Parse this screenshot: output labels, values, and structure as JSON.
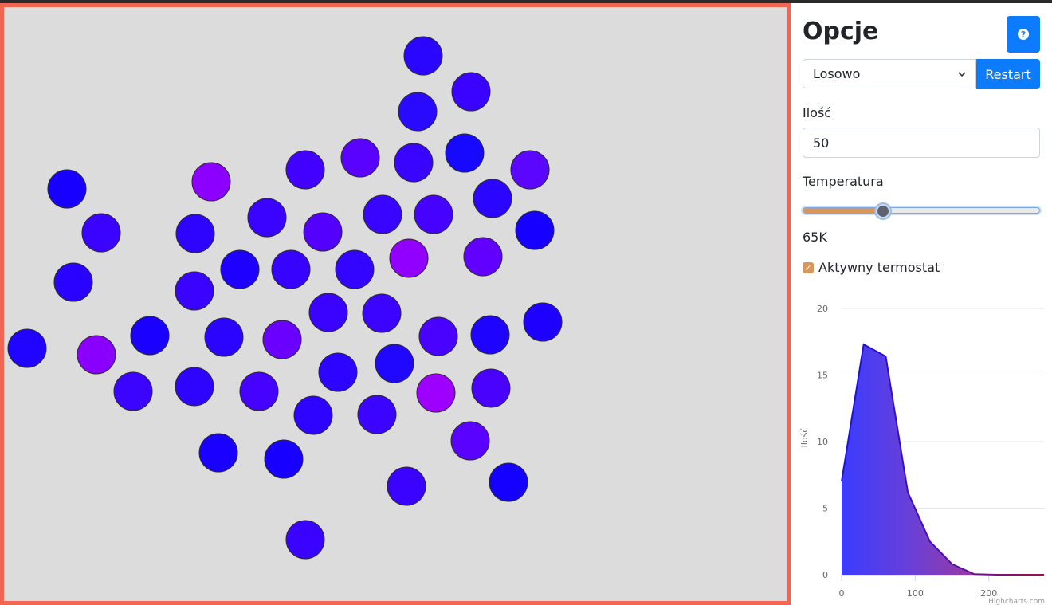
{
  "panel": {
    "title": "Opcje",
    "help_icon": "question-circle-icon",
    "mode_select": {
      "value": "Losowo"
    },
    "restart_label": "Restart",
    "count_label": "Ilość",
    "count_value": "50",
    "temperature_label": "Temperatura",
    "temperature_value": "65K",
    "temperature_level": 0.33,
    "thermostat_label": "Aktywny termostat",
    "thermostat_checked": true
  },
  "colors": {
    "sim_border": "#f26552",
    "sim_bg": "#dcdcdc",
    "primary": "#0d7bfd",
    "accent": "#d9955c"
  },
  "chart_data": {
    "type": "area",
    "ylabel": "Ilość",
    "xlabel": "",
    "ylim": [
      0,
      20
    ],
    "xlim": [
      0,
      275
    ],
    "yticks": [
      0,
      5,
      10,
      15,
      20
    ],
    "xticks": [
      0,
      100,
      200
    ],
    "credit": "Highcharts.com",
    "grid": true,
    "series": [
      {
        "x": [
          0,
          30,
          60,
          90,
          120,
          150,
          180,
          210,
          240,
          275
        ],
        "values": [
          7,
          17.3,
          16.4,
          6.2,
          2.5,
          0.8,
          0.05,
          0,
          0,
          0
        ]
      }
    ]
  }
}
